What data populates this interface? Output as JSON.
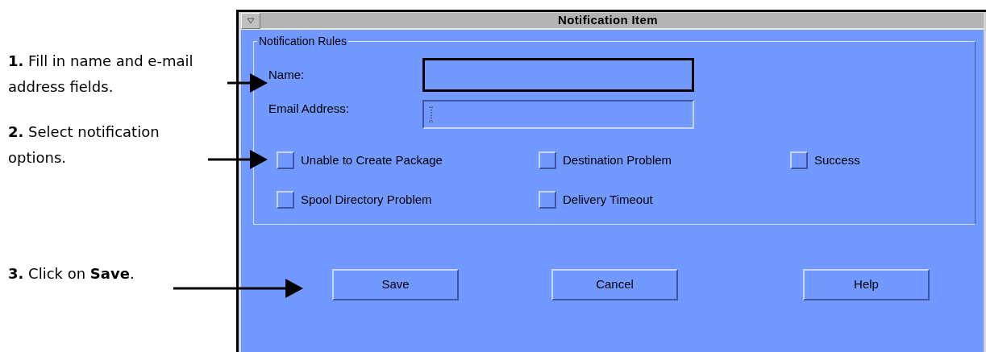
{
  "steps": [
    {
      "text": "**1.** Fill in name and e-mail address fields."
    },
    {
      "text": "**2.**  Select notification options."
    },
    {
      "text": "**3.**  Click on **Save**."
    }
  ],
  "window": {
    "title": "Notification Item"
  },
  "group": {
    "title": "Notification Rules"
  },
  "fields": [
    {
      "label": "Name:",
      "focused": true
    },
    {
      "label": "Email Address:",
      "focused": false
    }
  ],
  "options": [
    {
      "label": "Unable to Create Package",
      "checked": false
    },
    {
      "label": "Destination Problem",
      "checked": false
    },
    {
      "label": "Success",
      "checked": false
    },
    {
      "label": "Spool Directory Problem",
      "checked": false
    },
    {
      "label": "Delivery Timeout",
      "checked": false
    }
  ],
  "buttons": [
    "Save",
    "Cancel",
    "Help"
  ]
}
